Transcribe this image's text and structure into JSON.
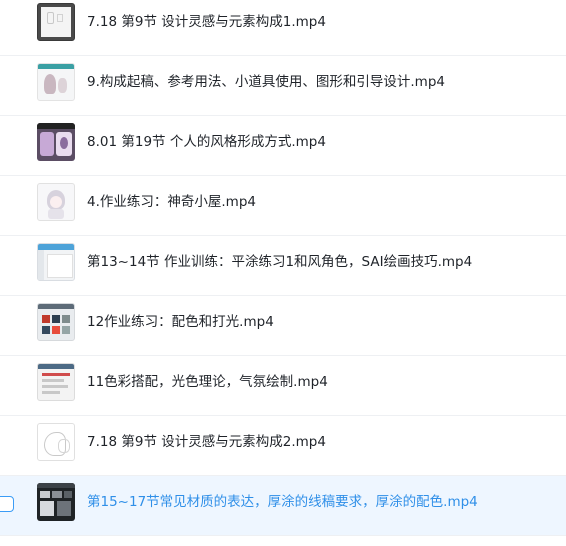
{
  "files": [
    {
      "name": "7.18 第9节 设计灵感与元素构成1.mp4"
    },
    {
      "name": "9.构成起稿、参考用法、小道具使用、图形和引导设计.mp4"
    },
    {
      "name": "8.01 第19节 个人的风格形成方式.mp4"
    },
    {
      "name": "4.作业练习：神奇小屋.mp4"
    },
    {
      "name": "第13~14节 作业训练：平涂练习1和风角色，SAI绘画技巧.mp4"
    },
    {
      "name": "12作业练习：配色和打光.mp4"
    },
    {
      "name": "11色彩搭配，光色理论，气氛绘制.mp4"
    },
    {
      "name": "7.18 第9节 设计灵感与元素构成2.mp4"
    },
    {
      "name": "第15~17节常见材质的表达，厚涂的线稿要求，厚涂的配色.mp4",
      "selected": true
    }
  ],
  "colors": {
    "selected_text": "#2f8fe8",
    "selected_background": "#eef6ff",
    "default_text": "#1f2329"
  }
}
